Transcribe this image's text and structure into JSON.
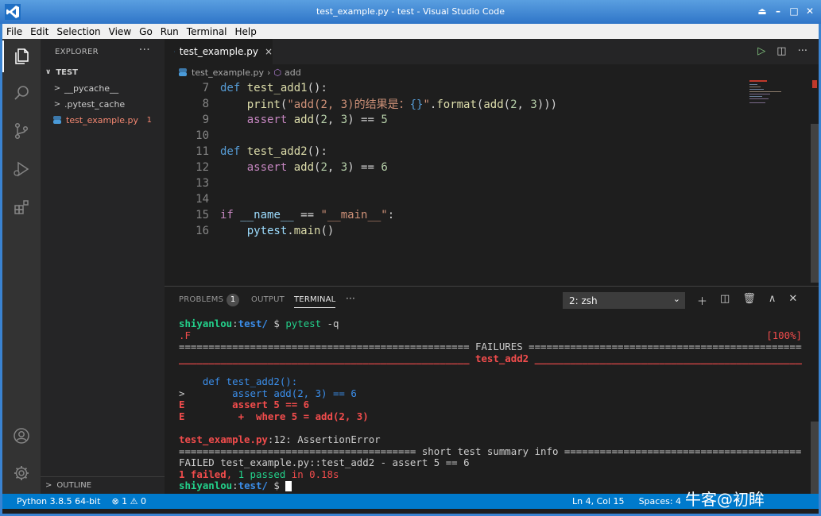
{
  "window": {
    "title": "test_example.py - test - Visual Studio Code"
  },
  "menu": [
    "File",
    "Edit",
    "Selection",
    "View",
    "Go",
    "Run",
    "Terminal",
    "Help"
  ],
  "activity": [
    "explorer-icon",
    "search-icon",
    "source-control-icon",
    "run-debug-icon",
    "extensions-icon",
    "account-icon",
    "settings-gear-icon"
  ],
  "sidebar": {
    "header": "EXPLORER",
    "more": "···",
    "folder": "TEST",
    "items": [
      {
        "label": "__pycache__",
        "chev": ">"
      },
      {
        "label": ".pytest_cache",
        "chev": ">"
      },
      {
        "label": "test_example.py",
        "badge": "1"
      }
    ],
    "outline": "OUTLINE"
  },
  "tab": {
    "label": "test_example.py",
    "close": "×"
  },
  "breadcrumb": {
    "file": "test_example.py",
    "symbol": "add"
  },
  "code_lines": [
    "7",
    "8",
    "9",
    "10",
    "11",
    "12",
    "13",
    "14",
    "15",
    "16"
  ],
  "panel": {
    "tabs": {
      "problems": "PROBLEMS",
      "problems_count": "1",
      "output": "OUTPUT",
      "terminal": "TERMINAL",
      "more": "···"
    },
    "terminal_select": "2: zsh"
  },
  "terminal": {
    "prompt_user": "shiyanlou",
    "prompt_dir": "test/",
    "cmd": "pytest -q",
    "progress": ".F",
    "percent": "[100%]",
    "failures_line": "================================================= FAILURES ==================================================",
    "test_name_line": "_________________________________________________ test_add2 _________________________________________________",
    "code1": "    def test_add2():",
    "code2_prefix": ">",
    "code2": "        assert add(2, 3) == 6",
    "e1_prefix": "E",
    "e1": "        assert 5 == 6",
    "e2_prefix": "E",
    "e2": "         +  where 5 = add(2, 3)",
    "err_file": "test_example.py",
    "err_rest": ":12: AssertionError",
    "summary_line": "======================================== short test summary info ========================================",
    "failed_line": "FAILED test_example.py::test_add2 - assert 5 == 6",
    "result_failed": "1 failed",
    "result_sep": ", ",
    "result_passed": "1 passed",
    "result_time": " in 0.18s"
  },
  "status": {
    "python": "Python 3.8.5 64-bit",
    "errors": "⊗ 1 ⚠ 0",
    "position": "Ln 4, Col 15",
    "spaces": "Spaces: 4"
  },
  "watermark": "牛客@初眸",
  "colors": {
    "accent": "#007acc",
    "error": "#f14c4c",
    "pass": "#23d18b",
    "blue": "#3b8eea"
  }
}
